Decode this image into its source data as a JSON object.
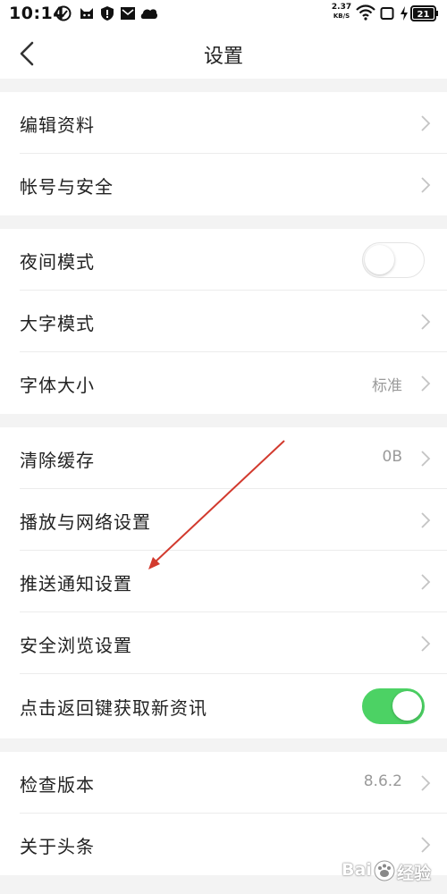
{
  "status_bar": {
    "time": "10:14",
    "net_speed_value": "2.37",
    "net_speed_unit": "KB/S",
    "battery_level": "21"
  },
  "nav": {
    "title": "设置"
  },
  "groups": [
    {
      "rows": [
        {
          "label": "编辑资料",
          "type": "chevron"
        },
        {
          "label": "帐号与安全",
          "type": "chevron"
        }
      ]
    },
    {
      "rows": [
        {
          "label": "夜间模式",
          "type": "toggle",
          "on": false
        },
        {
          "label": "大字模式",
          "type": "chevron"
        },
        {
          "label": "字体大小",
          "type": "chevron",
          "value": "标准"
        }
      ]
    },
    {
      "rows": [
        {
          "label": "清除缓存",
          "type": "chevron",
          "value": "0B"
        },
        {
          "label": "播放与网络设置",
          "type": "chevron"
        },
        {
          "label": "推送通知设置",
          "type": "chevron"
        },
        {
          "label": "安全浏览设置",
          "type": "chevron"
        },
        {
          "label": "点击返回键获取新资讯",
          "type": "toggle",
          "on": true
        }
      ]
    },
    {
      "rows": [
        {
          "label": "检查版本",
          "type": "chevron",
          "value": "8.6.2"
        },
        {
          "label": "关于头条",
          "type": "chevron"
        }
      ]
    }
  ],
  "colors": {
    "toggle_on": "#4cd264",
    "annotation_arrow": "#d23a2e",
    "separator": "#f3f3f3"
  },
  "watermark": {
    "text_left": "Bai",
    "text_right": "经验"
  }
}
